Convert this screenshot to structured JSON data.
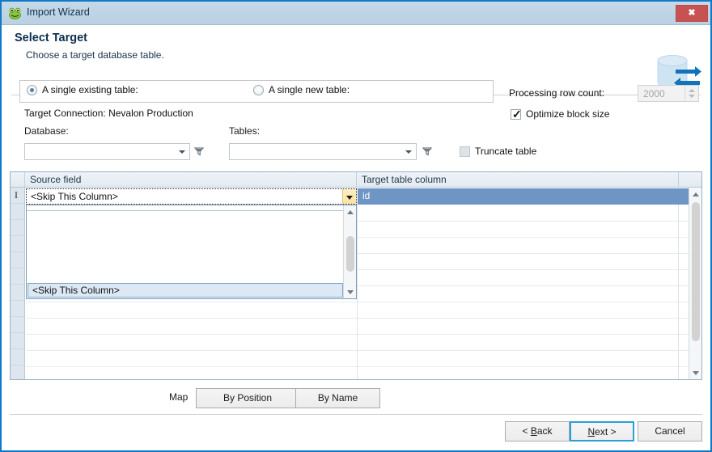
{
  "window": {
    "title": "Import Wizard",
    "icon": "toad-frog-icon",
    "close_label": "✖",
    "border_color": "#1279c6",
    "titlebar_color": "#bed3e4",
    "close_button_color": "#c75252"
  },
  "header": {
    "title": "Select Target",
    "subtitle": "Choose a target database table.",
    "illustration": "database-sync-icon"
  },
  "options": {
    "radio_existing_label": "A single existing table:",
    "radio_new_label": "A single new table:",
    "radio_selected": "existing",
    "target_connection": "Target Connection: Nevalon Production",
    "database_label": "Database:",
    "database_value": "",
    "tables_label": "Tables:",
    "tables_value": "",
    "processing_row_count_label": "Processing row count:",
    "processing_row_count_value": "2000",
    "optimize_block_size_label": "Optimize block size",
    "optimize_block_size_checked": true,
    "truncate_table_label": "Truncate table",
    "truncate_table_checked": false
  },
  "grid": {
    "columns": [
      "Source field",
      "Target table column"
    ],
    "rows": [
      {
        "source_field": "<Skip This Column>",
        "target_table_column": "id",
        "selected": true
      }
    ],
    "selected_row_color": "#6f95c4"
  },
  "dropdown": {
    "open": true,
    "selected_item": "<Skip This Column>",
    "partial_item": "·         ·"
  },
  "map": {
    "label": "Map",
    "by_position_label": "By Position",
    "by_name_label": "By Name"
  },
  "footer": {
    "back_label": "< Back",
    "back_prefix": "< ",
    "back_accel": "B",
    "back_suffix": "ack",
    "next_prefix": "",
    "next_accel": "N",
    "next_suffix": "ext >",
    "cancel_label": "Cancel",
    "default_button": "Next >"
  }
}
